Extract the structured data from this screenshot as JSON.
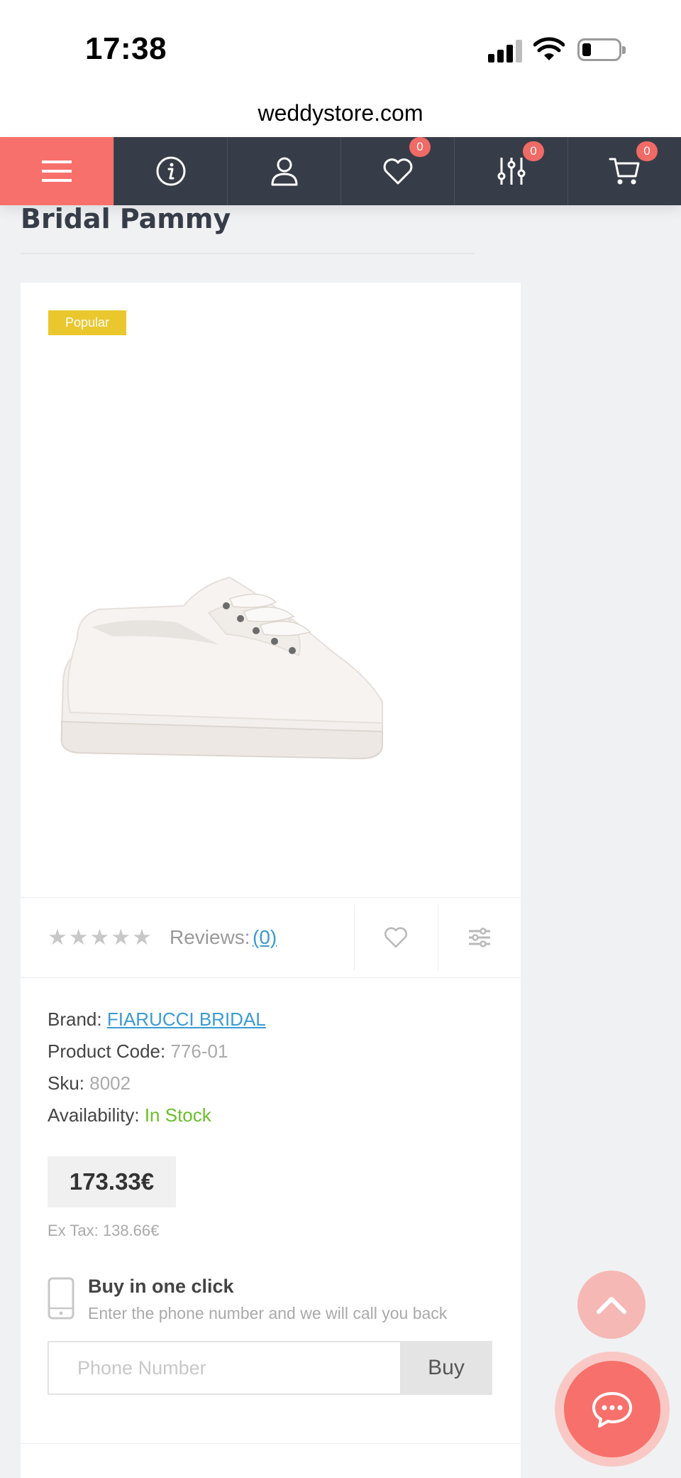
{
  "status_bar": {
    "time": "17:38"
  },
  "browser": {
    "url": "weddystore.com"
  },
  "nav": {
    "wishlist_count": "0",
    "compare_count": "0",
    "cart_count": "0"
  },
  "product": {
    "title": "Bridal Pammy",
    "badge": "Popular",
    "rating_stars": "★★★★★",
    "reviews_label": "Reviews:",
    "reviews_count": "(0)",
    "brand_label": "Brand:",
    "brand": "FIARUCCI BRIDAL",
    "code_label": "Product Code:",
    "code": "776-01",
    "sku_label": "Sku:",
    "sku": "8002",
    "availability_label": "Availability:",
    "availability": "In Stock",
    "price": "173.33€",
    "ex_tax": "Ex Tax: 138.66€"
  },
  "one_click": {
    "title": "Buy in one click",
    "subtitle": "Enter the phone number and we will call you back",
    "phone_placeholder": "Phone Number",
    "buy_label": "Buy"
  },
  "icons": {
    "menu": "hamburger-icon",
    "info": "info-icon",
    "account": "user-icon",
    "wishlist": "heart-icon",
    "compare": "sliders-icon",
    "cart": "cart-icon",
    "scroll_top": "chevron-up-icon",
    "chat": "chat-icon"
  },
  "colors": {
    "accent": "#f8706b",
    "nav_bg": "#373d48",
    "badge": "#ebc72e",
    "link": "#3a9bd5",
    "in_stock": "#6abf2a"
  }
}
